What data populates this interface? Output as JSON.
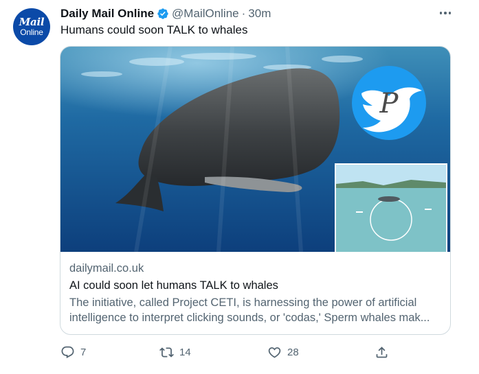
{
  "tweet": {
    "author_name": "Daily Mail Online",
    "avatar_text_line1": "Mail",
    "avatar_text_line2": "Online",
    "handle": "@MailOnline",
    "separator": "·",
    "time": "30m",
    "text": "Humans could soon TALK to whales",
    "verified_icon": "verified-badge-icon",
    "menu_icon": "more-options-icon"
  },
  "card": {
    "domain": "dailymail.co.uk",
    "title": "AI could soon let humans TALK to whales",
    "description": "The initiative, called Project CETI, is harnessing the power of artificial intelligence to interpret clicking sounds, or 'codas,' Sperm whales mak...",
    "image_alt": "sperm-whale-photo",
    "watermark_letter": "P",
    "inset_icon": "project-ceti-diagram-thumbnail"
  },
  "actions": {
    "reply_count": "7",
    "retweet_count": "14",
    "like_count": "28",
    "reply_icon": "reply-icon",
    "retweet_icon": "retweet-icon",
    "like_icon": "heart-icon",
    "share_icon": "share-icon"
  },
  "colors": {
    "accent": "#1d9bf0",
    "text_primary": "#0f1419",
    "text_secondary": "#536471",
    "border": "#cfd9de",
    "mail_blue": "#0b4aa8"
  }
}
